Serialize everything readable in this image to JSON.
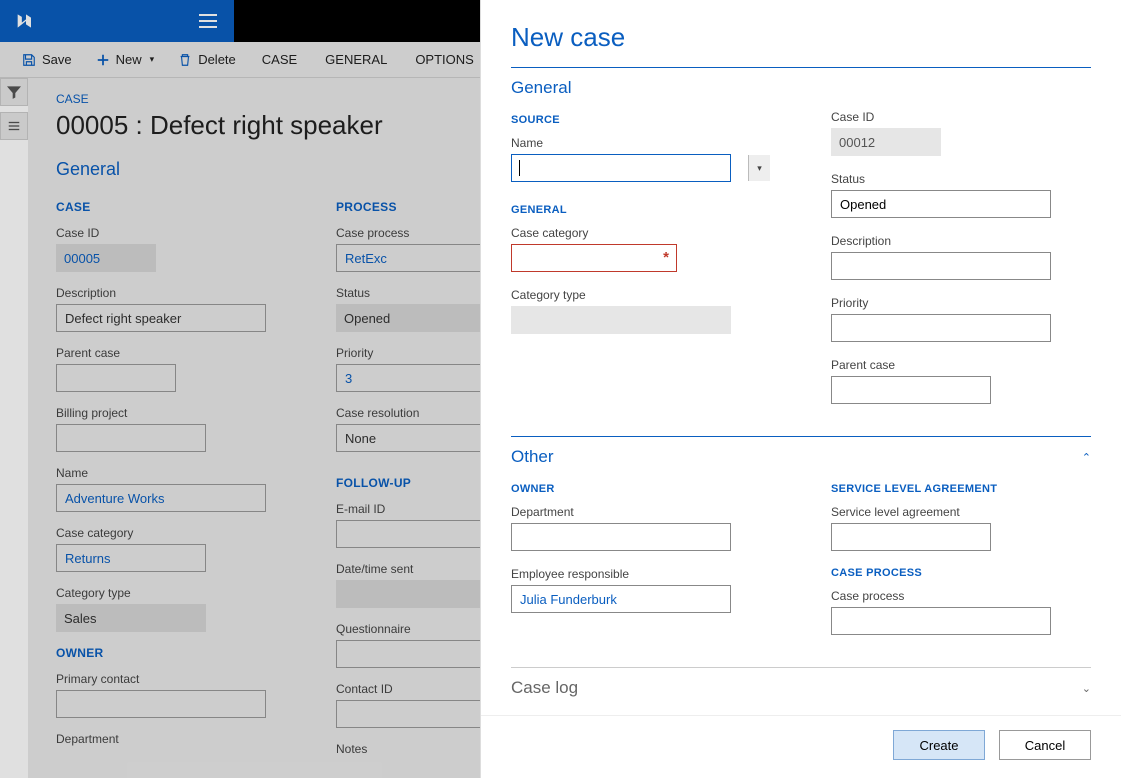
{
  "topbar": {
    "menu_tooltip": "Menu"
  },
  "actionbar": {
    "save": "Save",
    "new": "New",
    "delete": "Delete",
    "tabs": [
      "CASE",
      "GENERAL",
      "OPTIONS"
    ]
  },
  "bg": {
    "breadcrumb": "CASE",
    "title": "00005 : Defect right speaker",
    "section": "General",
    "col1": {
      "group1": "CASE",
      "case_id_label": "Case ID",
      "case_id": "00005",
      "description_label": "Description",
      "description": "Defect right speaker",
      "parent_case_label": "Parent case",
      "parent_case": "",
      "billing_project_label": "Billing project",
      "billing_project": "",
      "name_label": "Name",
      "name": "Adventure Works",
      "case_category_label": "Case category",
      "case_category": "Returns",
      "category_type_label": "Category type",
      "category_type": "Sales",
      "group2": "OWNER",
      "primary_contact_label": "Primary contact",
      "primary_contact": "",
      "department_label": "Department"
    },
    "col2": {
      "group1": "PROCESS",
      "case_process_label": "Case process",
      "case_process": "RetExc",
      "status_label": "Status",
      "status": "Opened",
      "priority_label": "Priority",
      "priority": "3",
      "case_resolution_label": "Case resolution",
      "case_resolution": "None",
      "group2": "FOLLOW-UP",
      "email_id_label": "E-mail ID",
      "email_id": "",
      "date_sent_label": "Date/time sent",
      "date_sent": "",
      "questionnaire_label": "Questionnaire",
      "questionnaire": "",
      "contact_id_label": "Contact ID",
      "contact_id": "",
      "notes_label": "Notes"
    }
  },
  "panel": {
    "title": "New case",
    "section_general": "General",
    "section_other": "Other",
    "section_log": "Case log",
    "left": {
      "group_source": "SOURCE",
      "name_label": "Name",
      "name": "",
      "group_general": "GENERAL",
      "case_category_label": "Case category",
      "case_category": "",
      "category_type_label": "Category type",
      "category_type": ""
    },
    "right": {
      "case_id_label": "Case ID",
      "case_id": "00012",
      "status_label": "Status",
      "status": "Opened",
      "description_label": "Description",
      "description": "",
      "priority_label": "Priority",
      "priority": "",
      "parent_case_label": "Parent case",
      "parent_case": ""
    },
    "other_left": {
      "group_owner": "OWNER",
      "department_label": "Department",
      "department": "",
      "employee_label": "Employee responsible",
      "employee": "Julia Funderburk"
    },
    "other_right": {
      "group_sla": "SERVICE LEVEL AGREEMENT",
      "sla_label": "Service level agreement",
      "sla": "",
      "group_process": "CASE PROCESS",
      "process_label": "Case process",
      "process": ""
    },
    "footer": {
      "create": "Create",
      "cancel": "Cancel"
    }
  }
}
